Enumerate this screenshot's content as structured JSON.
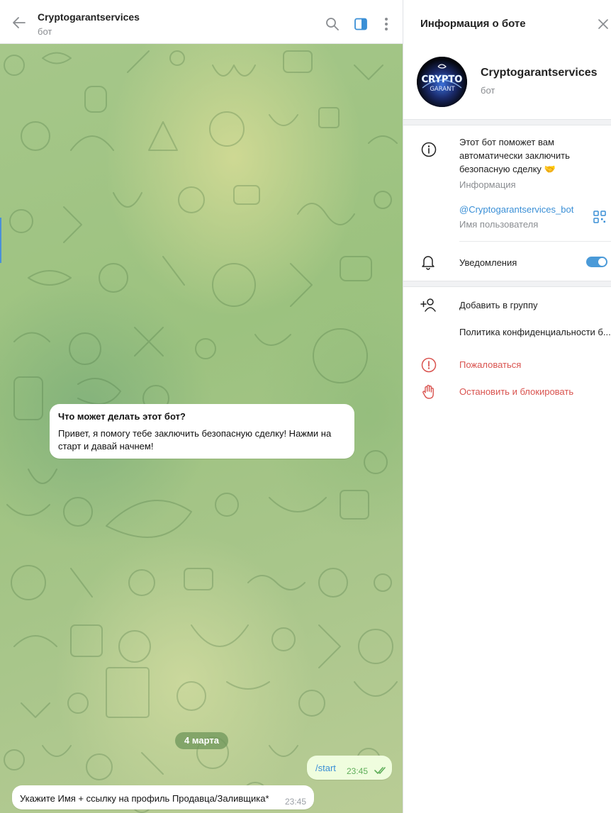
{
  "chat": {
    "header": {
      "title": "Cryptogarantservices",
      "subtitle": "бот",
      "icons": [
        "back-arrow-icon",
        "search-icon",
        "side-panel-icon",
        "more-vertical-icon"
      ]
    },
    "info_card": {
      "title": "Что может делать этот бот?",
      "text": "Привет, я помогу тебе заключить безопасную сделку! Нажми на старт и давай начнем!"
    },
    "date_divider": "4 марта",
    "messages": [
      {
        "direction": "out",
        "text": "/start",
        "time": "23:45",
        "status": "read"
      },
      {
        "direction": "in",
        "text": "Укажите Имя + ссылку на профиль Продавца/Заливщика*",
        "time": "23:45"
      }
    ],
    "colors": {
      "outgoing_bubble": "#effdde",
      "link": "#3a8fd6",
      "wallpaper": "#a6c78a"
    }
  },
  "info_panel": {
    "title": "Информация о боте",
    "avatar": {
      "lines": [
        "CRYPTO",
        "GARANT"
      ]
    },
    "name": "Cryptogarantservices",
    "status": "бот",
    "about_text": "Этот бот поможет вам автоматически заключить безопасную сделку 🤝",
    "about_label": "Информация",
    "username": "@Cryptogarantservices_bot",
    "username_label": "Имя пользователя",
    "notifications_label": "Уведомления",
    "notifications_on": true,
    "actions": [
      {
        "label": "Добавить в группу",
        "icon": "add-user-icon",
        "danger": false
      },
      {
        "label": "Политика конфиденциальности б...",
        "icon": "",
        "danger": false
      },
      {
        "label": "Пожаловаться",
        "icon": "report-icon",
        "danger": true
      },
      {
        "label": "Остановить и блокировать",
        "icon": "block-hand-icon",
        "danger": true
      }
    ],
    "colors": {
      "accent": "#4a9ad8",
      "danger": "#d9534f"
    }
  }
}
